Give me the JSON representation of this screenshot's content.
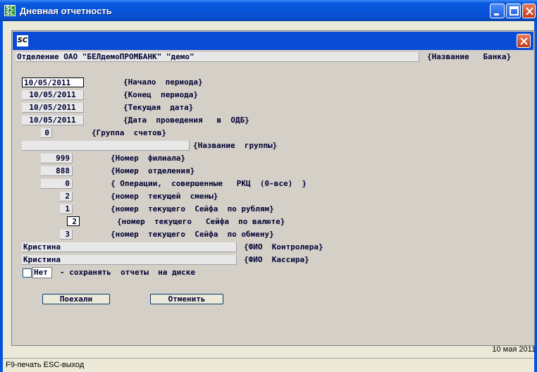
{
  "window": {
    "title": "Дневная отчетность"
  },
  "inner": {
    "icon_text": "SC"
  },
  "bank": {
    "name": "Отделение ОАО \"БЕЛдемоПРОМБАНК\" \"демо\"",
    "label": "{Название   Банка}"
  },
  "fields": {
    "period_start": {
      "value": "10/05/2011",
      "label": "{Начало  периода}"
    },
    "period_end": {
      "value": "10/05/2011",
      "label": "{Конец  периода}"
    },
    "current_date": {
      "value": "10/05/2011",
      "label": "{Текущая  дата}"
    },
    "odb_date": {
      "value": "10/05/2011",
      "label": "{Дата  проведения   в  ОДБ}"
    },
    "account_group": {
      "value": "0",
      "label": "{Группа  счетов}"
    },
    "group_name": {
      "value": "",
      "label": "{Название  группы}"
    },
    "branch_number": {
      "value": "999",
      "label": "{Номер  филиала}"
    },
    "department_number": {
      "value": "888",
      "label": "{Номер  отделения}"
    },
    "rkc_operations": {
      "value": "0",
      "label": "{ Операции,  совершенные   РКЦ  (0-все)  }"
    },
    "shift_number": {
      "value": "2",
      "label": "{номер  текущей  смены}"
    },
    "safe_rubles": {
      "value": "1",
      "label": "{номер  текущего  Сейфа  по рублям}"
    },
    "safe_currency": {
      "value": "2",
      "label": "{номер  текущего   Сейфа  по валюте}"
    },
    "safe_exchange": {
      "value": "3",
      "label": "{номер  текущего  Сейфа  по обмену}"
    },
    "controller_name": {
      "value": "Кристина",
      "label": "{ФИО  Контролера}"
    },
    "cashier_name": {
      "value": "Кристина",
      "label": "{ФИО  Кассира}"
    }
  },
  "save_option": {
    "value": "Нет",
    "label": "- сохранять  отчеты  на диске"
  },
  "buttons": {
    "go": "Поехали",
    "cancel": "Отменить"
  },
  "date_stamp": "10 мая 2011",
  "status_bar": "F9-печать ESC-выход"
}
